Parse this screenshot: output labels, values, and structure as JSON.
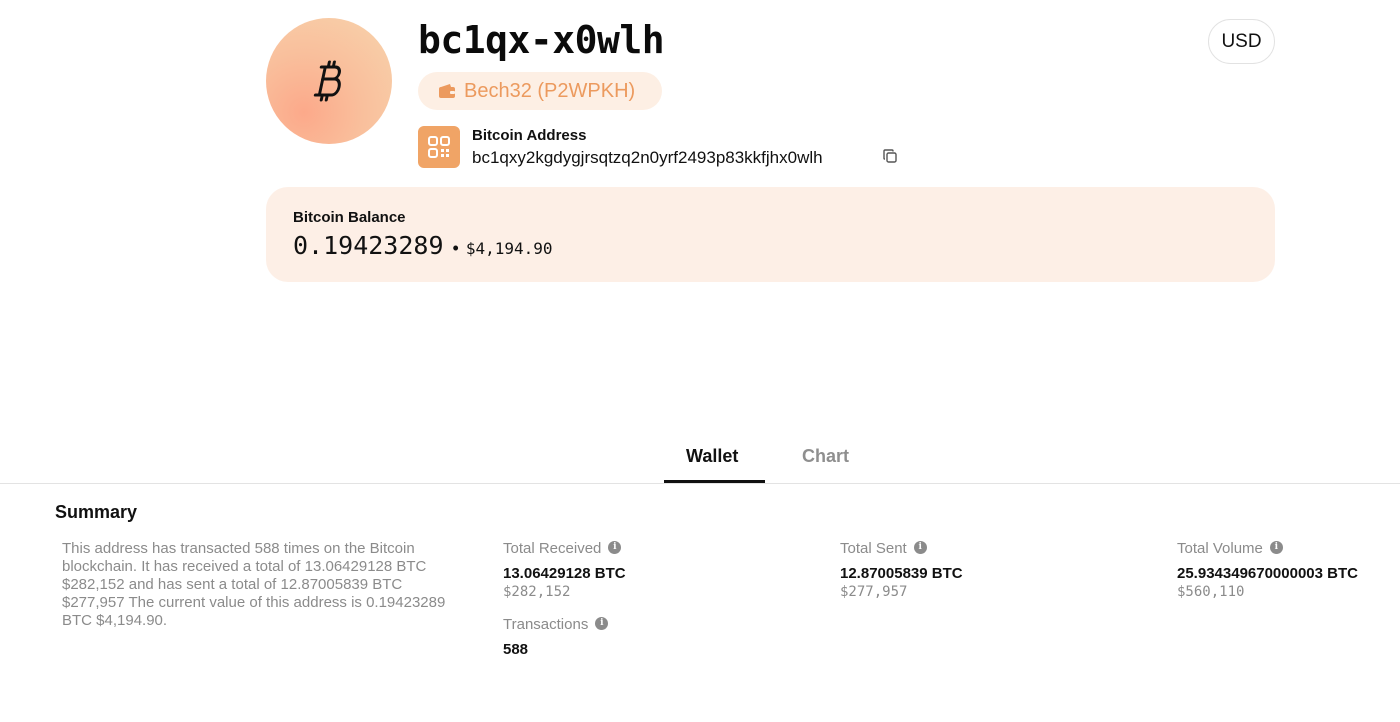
{
  "header": {
    "address_short": "bc1qx-x0wlh",
    "address_type": "Bech32 (P2WPKH)",
    "address_label": "Bitcoin Address",
    "address_full": "bc1qxy2kgdygjrsqtzq2n0yrf2493p83kkfjhx0wlh",
    "currency": "USD",
    "avatar_icon": "bitcoin-icon",
    "type_icon": "wallet-icon",
    "qr_icon": "qr-code-icon",
    "copy_icon": "copy-icon"
  },
  "balance": {
    "label": "Bitcoin Balance",
    "btc": "0.19423289",
    "separator": "•",
    "usd": "$4,194.90"
  },
  "tabs": [
    {
      "label": "Wallet",
      "active": true
    },
    {
      "label": "Chart",
      "active": false
    }
  ],
  "summary": {
    "title": "Summary",
    "text": "This address has transacted 588 times on the Bitcoin blockchain. It has received a total of 13.06429128 BTC $282,152 and has sent a total of 12.87005839 BTC $277,957 The current value of this address is 0.19423289 BTC $4,194.90.",
    "stats": {
      "received": {
        "label": "Total Received",
        "value": "13.06429128 BTC",
        "usd": "$282,152"
      },
      "sent": {
        "label": "Total Sent",
        "value": "12.87005839 BTC",
        "usd": "$277,957"
      },
      "volume": {
        "label": "Total Volume",
        "value": "25.934349670000003 BTC",
        "usd": "$560,110"
      },
      "transactions": {
        "label": "Transactions",
        "value": "588"
      }
    }
  },
  "colors": {
    "accent": "#f0a466",
    "accent_text": "#ec9a5e",
    "balance_bg": "#fdefe6",
    "muted_text": "#8b8b8b"
  }
}
